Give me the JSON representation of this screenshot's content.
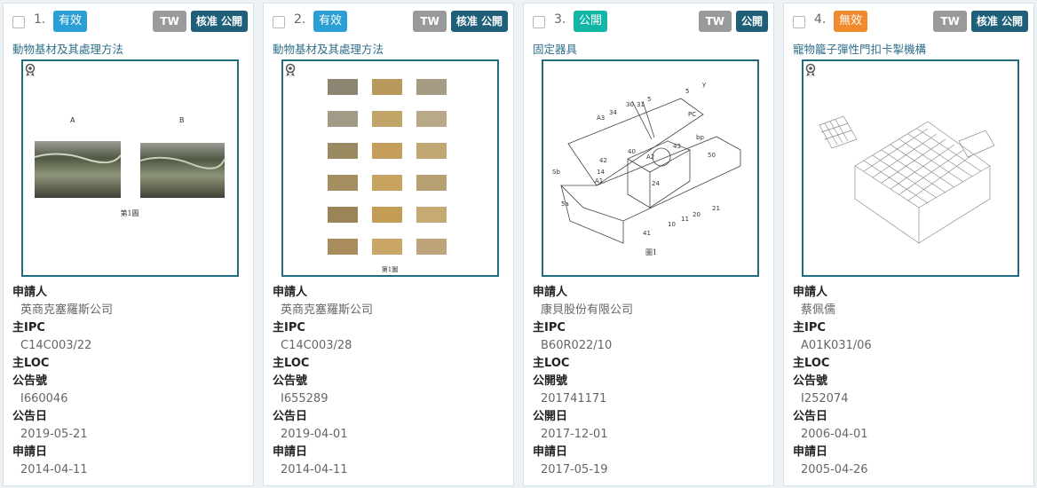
{
  "colors": {
    "active": "#2a9fd6",
    "public": "#13b5a5",
    "invalid": "#f08a2c",
    "tw": "#9a9a9a",
    "dark": "#1e5f7a"
  },
  "cards": [
    {
      "num": "1.",
      "status": "有效",
      "status_color": "#2a9fd6",
      "tags": [
        "TW",
        "核准 公開"
      ],
      "title": "動物基材及其處理方法",
      "image_icon": "award-icon",
      "figure_caption": "第1圖",
      "figure_labels": [
        "A",
        "B"
      ],
      "fields": [
        {
          "label": "申請人",
          "value": "英商克塞羅斯公司"
        },
        {
          "label": "主IPC",
          "value": "C14C003/22"
        },
        {
          "label": "主LOC",
          "value": ""
        },
        {
          "label": "公告號",
          "value": "I660046"
        },
        {
          "label": "公告日",
          "value": "2019-05-21"
        },
        {
          "label": "申請日",
          "value": "2014-04-11"
        }
      ]
    },
    {
      "num": "2.",
      "status": "有效",
      "status_color": "#2a9fd6",
      "tags": [
        "TW",
        "核准 公開"
      ],
      "title": "動物基材及其處理方法",
      "image_icon": "award-icon",
      "figure_caption": "第1圖",
      "fields": [
        {
          "label": "申請人",
          "value": "英商克塞羅斯公司"
        },
        {
          "label": "主IPC",
          "value": "C14C003/28"
        },
        {
          "label": "主LOC",
          "value": ""
        },
        {
          "label": "公告號",
          "value": "I655289"
        },
        {
          "label": "公告日",
          "value": "2019-04-01"
        },
        {
          "label": "申請日",
          "value": "2014-04-11"
        }
      ]
    },
    {
      "num": "3.",
      "status": "公開",
      "status_color": "#13b5a5",
      "tags": [
        "TW",
        "公開"
      ],
      "title": "固定器具",
      "image_icon": "",
      "figure_caption": "圖1",
      "figure_labels": [
        "A3",
        "34",
        "30",
        "31",
        "5",
        "5",
        "PC",
        "y",
        "43",
        "bp",
        "40",
        "A2",
        "42",
        "14",
        "A1",
        "Sb",
        "24",
        "50",
        "5a",
        "41",
        "10",
        "11",
        "20",
        "21"
      ],
      "fields": [
        {
          "label": "申請人",
          "value": "康貝股份有限公司"
        },
        {
          "label": "主IPC",
          "value": "B60R022/10"
        },
        {
          "label": "主LOC",
          "value": ""
        },
        {
          "label": "公開號",
          "value": "201741171"
        },
        {
          "label": "公開日",
          "value": "2017-12-01"
        },
        {
          "label": "申請日",
          "value": "2017-05-19"
        }
      ]
    },
    {
      "num": "4.",
      "status": "無效",
      "status_color": "#f08a2c",
      "tags": [
        "TW",
        "核准 公開"
      ],
      "title": "寵物籠子彈性門扣卡掣機構",
      "image_icon": "award-icon",
      "figure_caption": "",
      "fields": [
        {
          "label": "申請人",
          "value": "蔡佩儒"
        },
        {
          "label": "主IPC",
          "value": "A01K031/06"
        },
        {
          "label": "主LOC",
          "value": ""
        },
        {
          "label": "公告號",
          "value": "I252074"
        },
        {
          "label": "公告日",
          "value": "2006-04-01"
        },
        {
          "label": "申請日",
          "value": "2005-04-26"
        }
      ]
    }
  ]
}
